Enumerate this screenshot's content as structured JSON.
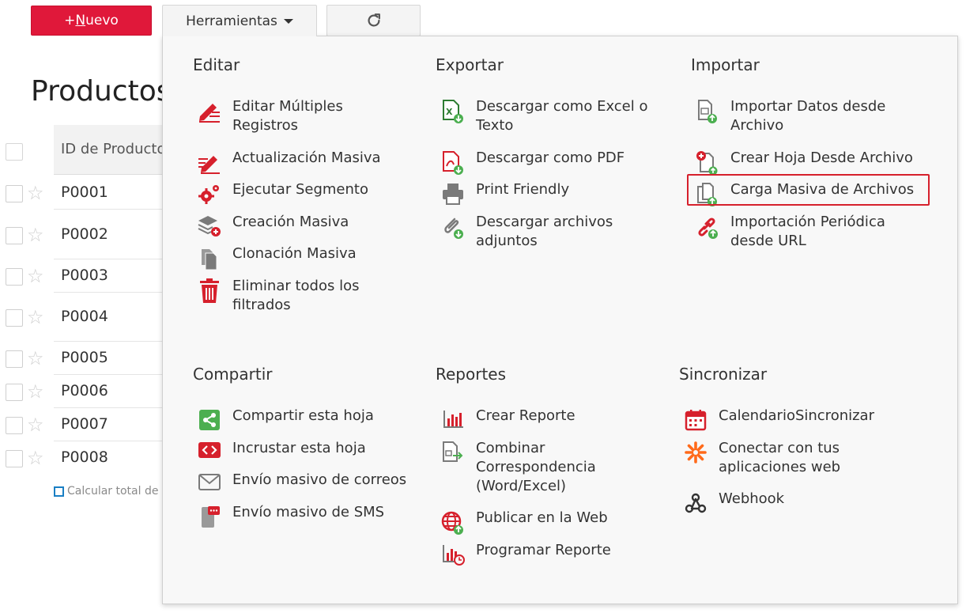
{
  "toolbar": {
    "new_prefix": "+",
    "new_underlined": "N",
    "new_rest": "uevo",
    "tools_label": "Herramientas",
    "refresh_icon": "refresh-icon"
  },
  "page": {
    "title": "Productos",
    "column_id": "ID de Producto",
    "rows": [
      "P0001",
      "P0002",
      "P0003",
      "P0004",
      "P0005",
      "P0006",
      "P0007",
      "P0008"
    ],
    "calc_label": "Calcular total de"
  },
  "menu": {
    "editar": {
      "title": "Editar",
      "items": [
        "Editar Múltiples Registros",
        "Actualización Masiva",
        "Ejecutar Segmento",
        "Creación Masiva",
        "Clonación Masiva",
        "Eliminar todos los filtrados"
      ]
    },
    "exportar": {
      "title": "Exportar",
      "items": [
        "Descargar como Excel o Texto",
        "Descargar como PDF",
        "Print Friendly",
        "Descargar archivos adjuntos"
      ]
    },
    "importar": {
      "title": "Importar",
      "items": [
        "Importar Datos desde Archivo",
        "Crear Hoja Desde Archivo",
        "Carga Masiva de Archivos",
        "Importación Periódica desde URL"
      ]
    },
    "compartir": {
      "title": "Compartir",
      "items": [
        "Compartir esta hoja",
        "Incrustar esta hoja",
        "Envío masivo de correos",
        "Envío masivo de SMS"
      ]
    },
    "reportes": {
      "title": "Reportes",
      "items": [
        "Crear Reporte",
        "Combinar Correspondencia (Word/Excel)",
        "Publicar en la Web",
        "Programar Reporte"
      ]
    },
    "sincronizar": {
      "title": "Sincronizar",
      "items": [
        "CalendarioSincronizar",
        "Conectar con tus aplicaciones web",
        "Webhook"
      ]
    }
  },
  "colors": {
    "brand_red": "#e0183a",
    "icon_red": "#d6202c",
    "icon_green": "#4caf50",
    "icon_gray": "#7a7a7a",
    "highlight": "#d6202c"
  }
}
